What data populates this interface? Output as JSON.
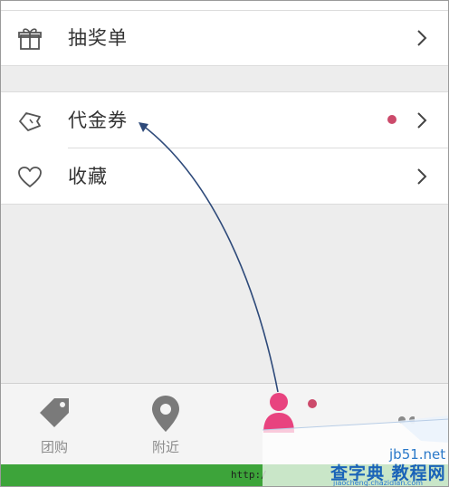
{
  "menu": {
    "lottery": {
      "label": "抽奖单",
      "icon": "gift-icon",
      "chevron": "chevron-right-icon"
    },
    "voucher": {
      "label": "代金券",
      "icon": "ticket-icon",
      "chevron": "chevron-right-icon",
      "has_badge": true
    },
    "favorites": {
      "label": "收藏",
      "icon": "heart-icon",
      "chevron": "chevron-right-icon"
    }
  },
  "tabbar": {
    "items": [
      {
        "label": "团购",
        "icon": "tag-icon"
      },
      {
        "label": "附近",
        "icon": "location-pin-icon"
      },
      {
        "label": "",
        "icon": "user-icon",
        "active": true,
        "has_badge": true
      },
      {
        "label": "",
        "icon": "more-icon"
      }
    ]
  },
  "browser": {
    "url_text": "http:/"
  },
  "watermark": {
    "site": "jb51.net",
    "name": "查字典 教程网",
    "domain": "jiaocheng.chazidian.com"
  },
  "colors": {
    "accent": "#e8437f",
    "badge": "#cc4a6b",
    "annotation_arrow": "#2e4a7a",
    "status_green": "#3da43a"
  }
}
